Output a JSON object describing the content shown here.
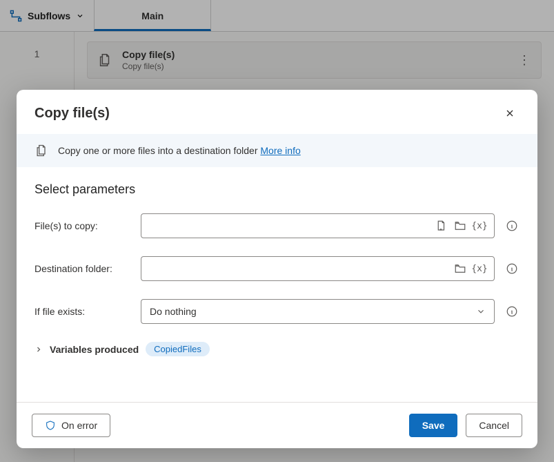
{
  "topbar": {
    "subflows_label": "Subflows",
    "main_tab_label": "Main"
  },
  "canvas": {
    "line_number": "1",
    "step": {
      "title": "Copy file(s)",
      "subtitle": "Copy file(s)"
    }
  },
  "modal": {
    "title": "Copy file(s)",
    "info_text": "Copy one or more files into a destination folder ",
    "info_link_label": "More info",
    "section_heading": "Select parameters",
    "fields": {
      "files_label": "File(s) to copy:",
      "files_value": "",
      "dest_label": "Destination folder:",
      "dest_value": "",
      "exists_label": "If file exists:",
      "exists_value": "Do nothing"
    },
    "variables": {
      "expander_label": "Variables produced",
      "pill_label": "CopiedFiles"
    },
    "footer": {
      "on_error_label": "On error",
      "save_label": "Save",
      "cancel_label": "Cancel"
    }
  }
}
